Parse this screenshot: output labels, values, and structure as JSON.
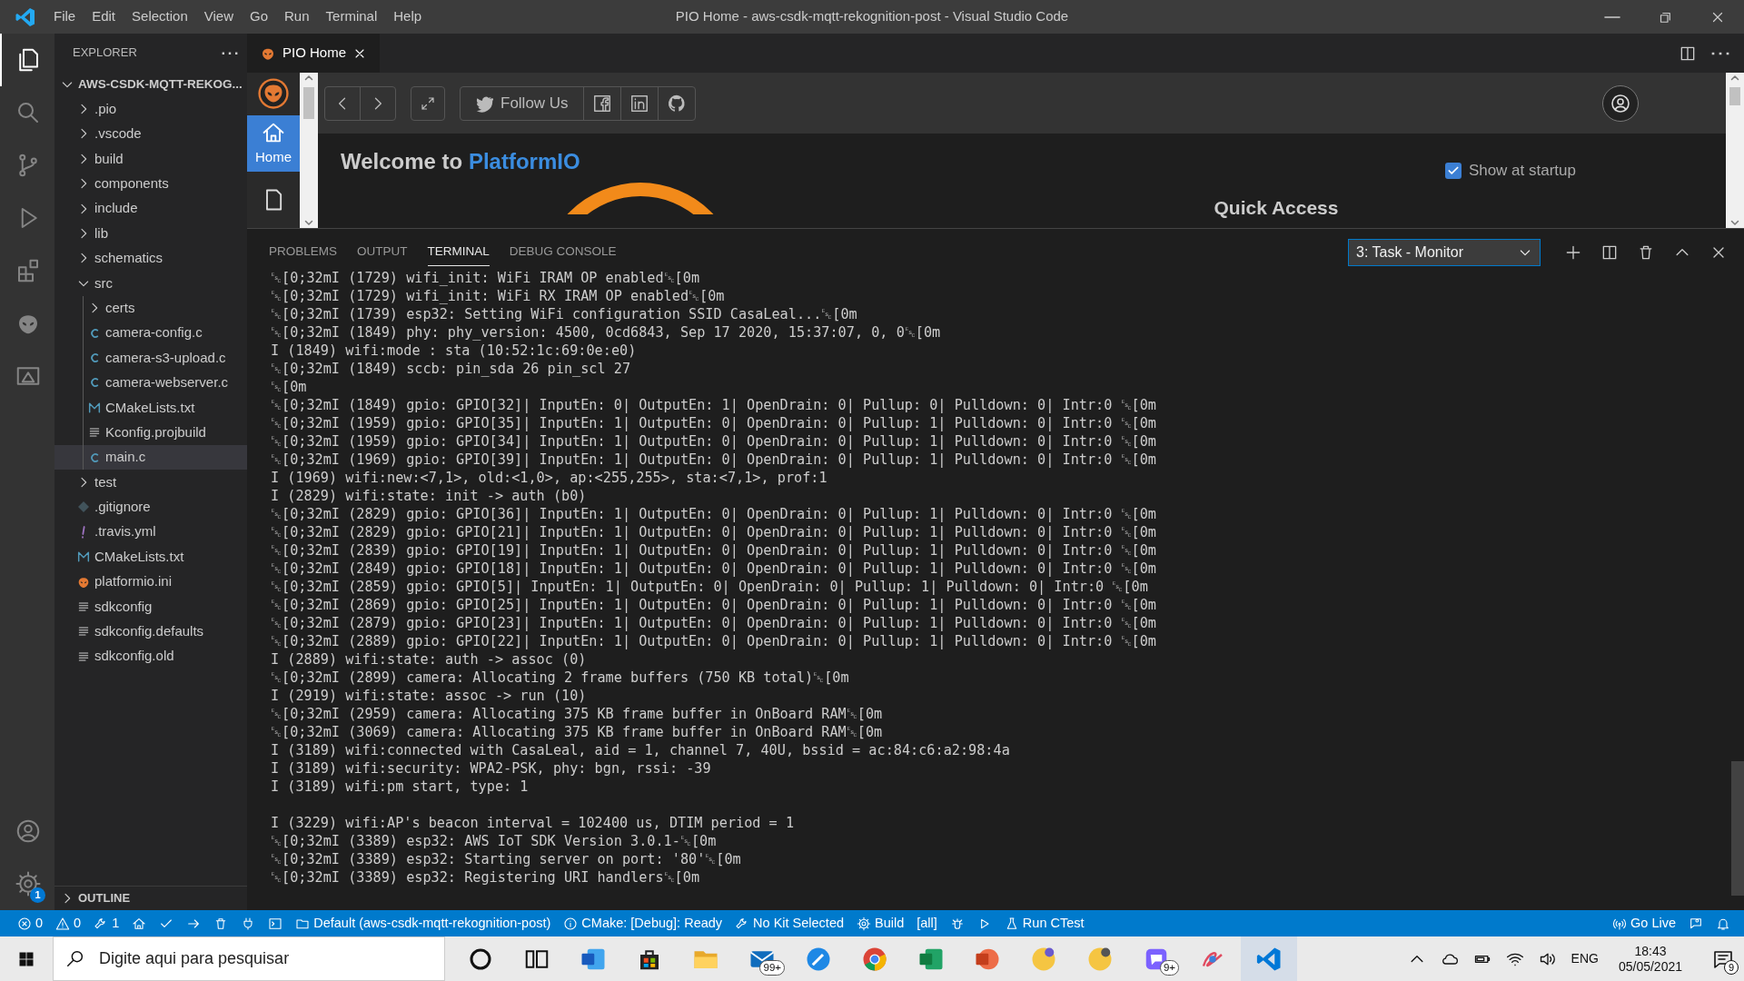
{
  "window": {
    "title": "PIO Home - aws-csdk-mqtt-rekognition-post - Visual Studio Code"
  },
  "menu": [
    "File",
    "Edit",
    "Selection",
    "View",
    "Go",
    "Run",
    "Terminal",
    "Help"
  ],
  "activity_bar": {
    "items": [
      {
        "kind": "files",
        "selected": true
      },
      {
        "kind": "search",
        "selected": false
      },
      {
        "kind": "source_control",
        "selected": false
      },
      {
        "kind": "run",
        "selected": false
      },
      {
        "kind": "extensions",
        "selected": false
      },
      {
        "kind": "alien",
        "selected": false
      },
      {
        "kind": "remote",
        "selected": false
      }
    ],
    "bottom": [
      {
        "kind": "account"
      },
      {
        "kind": "settings",
        "badge": "1"
      }
    ]
  },
  "sidebar": {
    "title": "EXPLORER",
    "root": {
      "label": "AWS-CSDK-MQTT-REKOG...",
      "expanded": true
    },
    "items": [
      {
        "label": ".pio",
        "kind": "folder",
        "expanded": false
      },
      {
        "label": ".vscode",
        "kind": "folder",
        "expanded": false
      },
      {
        "label": "build",
        "kind": "folder",
        "expanded": false
      },
      {
        "label": "components",
        "kind": "folder",
        "expanded": false
      },
      {
        "label": "include",
        "kind": "folder",
        "expanded": false
      },
      {
        "label": "lib",
        "kind": "folder",
        "expanded": false
      },
      {
        "label": "schematics",
        "kind": "folder",
        "expanded": false
      },
      {
        "label": "src",
        "kind": "folder",
        "expanded": true,
        "children": [
          {
            "label": "certs",
            "kind": "folder",
            "expanded": false
          },
          {
            "label": "camera-config.c",
            "kind": "c",
            "selected": false
          },
          {
            "label": "camera-s3-upload.c",
            "kind": "c",
            "selected": false
          },
          {
            "label": "camera-webserver.c",
            "kind": "c",
            "selected": false
          },
          {
            "label": "CMakeLists.txt",
            "kind": "cmake",
            "selected": false
          },
          {
            "label": "Kconfig.projbuild",
            "kind": "text",
            "selected": false
          },
          {
            "label": "main.c",
            "kind": "c",
            "selected": true
          }
        ]
      },
      {
        "label": "test",
        "kind": "folder",
        "expanded": false
      },
      {
        "label": ".gitignore",
        "kind": "git",
        "selected": false
      },
      {
        "label": ".travis.yml",
        "kind": "yaml",
        "selected": false
      },
      {
        "label": "CMakeLists.txt",
        "kind": "cmake",
        "selected": false
      },
      {
        "label": "platformio.ini",
        "kind": "pio",
        "selected": false
      },
      {
        "label": "sdkconfig",
        "kind": "text",
        "selected": false
      },
      {
        "label": "sdkconfig.defaults",
        "kind": "text",
        "selected": false
      },
      {
        "label": "sdkconfig.old",
        "kind": "text",
        "selected": false
      }
    ],
    "outline": {
      "label": "OUTLINE",
      "expanded": false
    }
  },
  "editor": {
    "tabs": [
      {
        "label": "PIO Home",
        "selected": true
      }
    ]
  },
  "pio_home": {
    "nav": [
      {
        "kind": "home",
        "label": "Home",
        "selected": true
      },
      {
        "kind": "document",
        "selected": false
      }
    ],
    "follow_label": "Follow Us",
    "welcome": {
      "text": "Welcome to",
      "highlight": "PlatformIO"
    },
    "show_at_startup": {
      "label": "Show at startup",
      "checked": true
    },
    "quick_access": "Quick Access"
  },
  "panel": {
    "tabs": [
      {
        "label": "PROBLEMS",
        "selected": false
      },
      {
        "label": "OUTPUT",
        "selected": false
      },
      {
        "label": "TERMINAL",
        "selected": true
      },
      {
        "label": "DEBUG CONSOLE",
        "selected": false
      }
    ],
    "terminal_select": "3: Task - Monitor",
    "lines": [
      {
        "kind": "log",
        "text": "␛[0;32mI (1729) wifi_init: WiFi IRAM OP enabled␛[0m"
      },
      {
        "kind": "log",
        "text": "␛[0;32mI (1729) wifi_init: WiFi RX IRAM OP enabled␛[0m"
      },
      {
        "kind": "log",
        "text": "␛[0;32mI (1739) esp32: Setting WiFi configuration SSID CasaLeal...␛[0m"
      },
      {
        "kind": "log",
        "text": "␛[0;32mI (1849) phy: phy_version: 4500, 0cd6843, Sep 17 2020, 15:37:07, 0, 0␛[0m"
      },
      {
        "kind": "log",
        "text": "I (1849) wifi:mode : sta (10:52:1c:69:0e:e0)"
      },
      {
        "kind": "log",
        "text": "␛[0;32mI (1849) sccb: pin_sda 26 pin_scl 27"
      },
      {
        "kind": "log",
        "text": "␛[0m"
      },
      {
        "kind": "log",
        "text": "␛[0;32mI (1849) gpio: GPIO[32]| InputEn: 0| OutputEn: 1| OpenDrain: 0| Pullup: 0| Pulldown: 0| Intr:0 ␛[0m"
      },
      {
        "kind": "log",
        "text": "␛[0;32mI (1959) gpio: GPIO[35]| InputEn: 1| OutputEn: 0| OpenDrain: 0| Pullup: 1| Pulldown: 0| Intr:0 ␛[0m"
      },
      {
        "kind": "log",
        "text": "␛[0;32mI (1959) gpio: GPIO[34]| InputEn: 1| OutputEn: 0| OpenDrain: 0| Pullup: 1| Pulldown: 0| Intr:0 ␛[0m"
      },
      {
        "kind": "log",
        "text": "␛[0;32mI (1969) gpio: GPIO[39]| InputEn: 1| OutputEn: 0| OpenDrain: 0| Pullup: 1| Pulldown: 0| Intr:0 ␛[0m"
      },
      {
        "kind": "log",
        "text": "I (1969) wifi:new:<7,1>, old:<1,0>, ap:<255,255>, sta:<7,1>, prof:1"
      },
      {
        "kind": "log",
        "text": "I (2829) wifi:state: init -> auth (b0)"
      },
      {
        "kind": "log",
        "text": "␛[0;32mI (2829) gpio: GPIO[36]| InputEn: 1| OutputEn: 0| OpenDrain: 0| Pullup: 1| Pulldown: 0| Intr:0 ␛[0m"
      },
      {
        "kind": "log",
        "text": "␛[0;32mI (2829) gpio: GPIO[21]| InputEn: 1| OutputEn: 0| OpenDrain: 0| Pullup: 1| Pulldown: 0| Intr:0 ␛[0m"
      },
      {
        "kind": "log",
        "text": "␛[0;32mI (2839) gpio: GPIO[19]| InputEn: 1| OutputEn: 0| OpenDrain: 0| Pullup: 1| Pulldown: 0| Intr:0 ␛[0m"
      },
      {
        "kind": "log",
        "text": "␛[0;32mI (2849) gpio: GPIO[18]| InputEn: 1| OutputEn: 0| OpenDrain: 0| Pullup: 1| Pulldown: 0| Intr:0 ␛[0m"
      },
      {
        "kind": "log",
        "text": "␛[0;32mI (2859) gpio: GPIO[5]| InputEn: 1| OutputEn: 0| OpenDrain: 0| Pullup: 1| Pulldown: 0| Intr:0 ␛[0m"
      },
      {
        "kind": "log",
        "text": "␛[0;32mI (2869) gpio: GPIO[25]| InputEn: 1| OutputEn: 0| OpenDrain: 0| Pullup: 1| Pulldown: 0| Intr:0 ␛[0m"
      },
      {
        "kind": "log",
        "text": "␛[0;32mI (2879) gpio: GPIO[23]| InputEn: 1| OutputEn: 0| OpenDrain: 0| Pullup: 1| Pulldown: 0| Intr:0 ␛[0m"
      },
      {
        "kind": "log",
        "text": "␛[0;32mI (2889) gpio: GPIO[22]| InputEn: 1| OutputEn: 0| OpenDrain: 0| Pullup: 1| Pulldown: 0| Intr:0 ␛[0m"
      },
      {
        "kind": "log",
        "text": "I (2889) wifi:state: auth -> assoc (0)"
      },
      {
        "kind": "log",
        "text": "␛[0;32mI (2899) camera: Allocating 2 frame buffers (750 KB total)␛[0m"
      },
      {
        "kind": "log",
        "text": "I (2919) wifi:state: assoc -> run (10)"
      },
      {
        "kind": "log",
        "text": "␛[0;32mI (2959) camera: Allocating 375 KB frame buffer in OnBoard RAM␛[0m"
      },
      {
        "kind": "log",
        "text": "␛[0;32mI (3069) camera: Allocating 375 KB frame buffer in OnBoard RAM␛[0m"
      },
      {
        "kind": "log",
        "text": "I (3189) wifi:connected with CasaLeal, aid = 1, channel 7, 40U, bssid = ac:84:c6:a2:98:4a"
      },
      {
        "kind": "log",
        "text": "I (3189) wifi:security: WPA2-PSK, phy: bgn, rssi: -39"
      },
      {
        "kind": "log",
        "text": "I (3189) wifi:pm start, type: 1"
      },
      {
        "kind": "gap"
      },
      {
        "kind": "log",
        "text": "I (3229) wifi:AP's beacon interval = 102400 us, DTIM period = 1"
      },
      {
        "kind": "log",
        "text": "␛[0;32mI (3389) esp32: AWS IoT SDK Version 3.0.1-␛[0m"
      },
      {
        "kind": "log",
        "text": "␛[0;32mI (3389) esp32: Starting server on port: '80'␛[0m"
      },
      {
        "kind": "log",
        "text": "␛[0;32mI (3389) esp32: Registering URI handlers␛[0m"
      }
    ]
  },
  "status_bar": {
    "left": [
      {
        "kind": "error",
        "text": "0"
      },
      {
        "kind": "warning",
        "text": "0"
      },
      {
        "kind": "tools",
        "text": "1"
      },
      {
        "kind": "home"
      },
      {
        "kind": "check"
      },
      {
        "kind": "arrow"
      },
      {
        "kind": "trash"
      },
      {
        "kind": "plug"
      },
      {
        "kind": "terminal"
      },
      {
        "kind": "folder",
        "text": "Default (aws-csdk-mqtt-rekognition-post)"
      },
      {
        "kind": "info",
        "text": "CMake: [Debug]: Ready"
      },
      {
        "kind": "tools",
        "text": "No Kit Selected"
      },
      {
        "kind": "settings",
        "text": "Build"
      },
      {
        "text": "[all]"
      },
      {
        "kind": "bug"
      },
      {
        "kind": "play"
      },
      {
        "kind": "flask",
        "text": "Run CTest"
      }
    ],
    "right": [
      {
        "kind": "broadcast",
        "text": "Go Live"
      },
      {
        "kind": "feedback"
      },
      {
        "kind": "bell"
      }
    ]
  },
  "taskbar": {
    "search_placeholder": "Digite aqui para pesquisar",
    "apps": [
      {
        "kind": "cortana",
        "active": false
      },
      {
        "kind": "taskview",
        "active": false
      },
      {
        "kind": "word",
        "active": false
      },
      {
        "kind": "store",
        "active": false
      },
      {
        "kind": "explorer",
        "active": false
      },
      {
        "kind": "mail",
        "active": false,
        "badge": "99+"
      },
      {
        "kind": "tool",
        "active": false
      },
      {
        "kind": "chrome",
        "active": false
      },
      {
        "kind": "excel",
        "active": false
      },
      {
        "kind": "powerpoint",
        "active": false
      },
      {
        "kind": "round",
        "active": false
      },
      {
        "kind": "round2",
        "active": false
      },
      {
        "kind": "chat",
        "active": false,
        "badge": "9+"
      },
      {
        "kind": "scribble",
        "active": false
      },
      {
        "kind": "vscode",
        "active": true
      }
    ],
    "language": "ENG",
    "time": "18:43",
    "date": "05/05/2021",
    "notifications": "9"
  }
}
